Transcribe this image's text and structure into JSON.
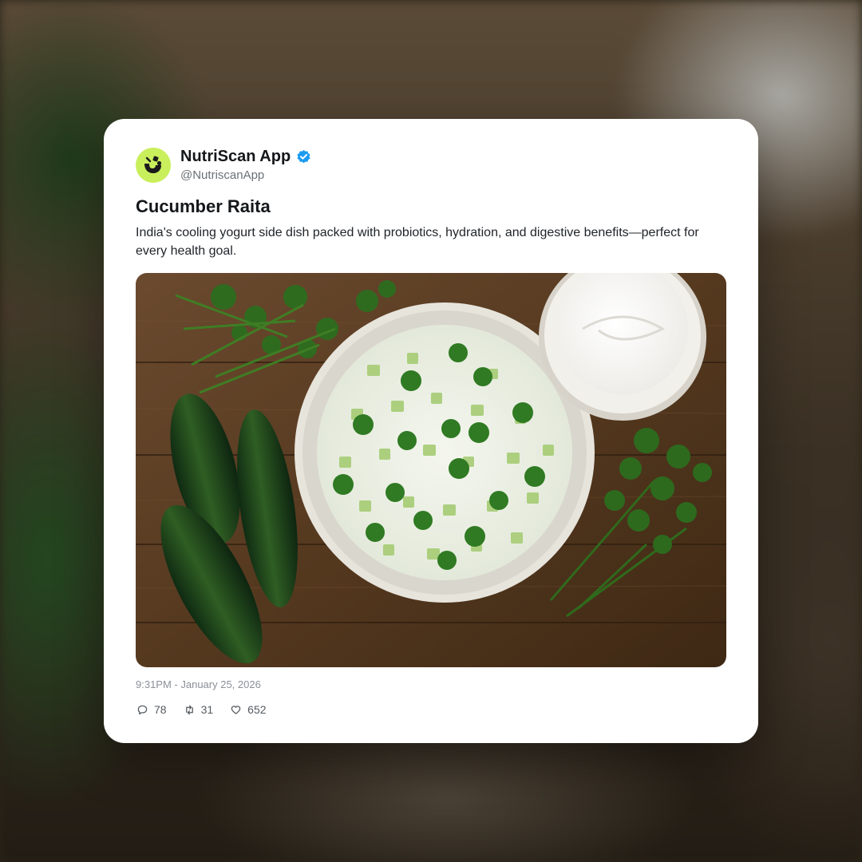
{
  "account": {
    "display_name": "NutriScan App",
    "handle": "@NutriscanApp",
    "verified": true,
    "avatar_color": "#c9ef5c"
  },
  "post": {
    "title": "Cucumber Raita",
    "description": "India's cooling yogurt side dish packed with probiotics, hydration, and digestive benefits—perfect for every health goal.",
    "timestamp": "9:31PM - January 25, 2026",
    "image_subject": "bowl of cucumber raita with cilantro, cucumbers and yogurt on wooden table"
  },
  "stats": {
    "replies": "78",
    "reposts": "31",
    "likes": "652"
  },
  "icons": {
    "verified": "verified-badge-icon",
    "reply": "reply-icon",
    "repost": "repost-icon",
    "like": "heart-icon"
  },
  "colors": {
    "verified_blue": "#1d9bf0",
    "accent_lime": "#c9ef5c"
  }
}
